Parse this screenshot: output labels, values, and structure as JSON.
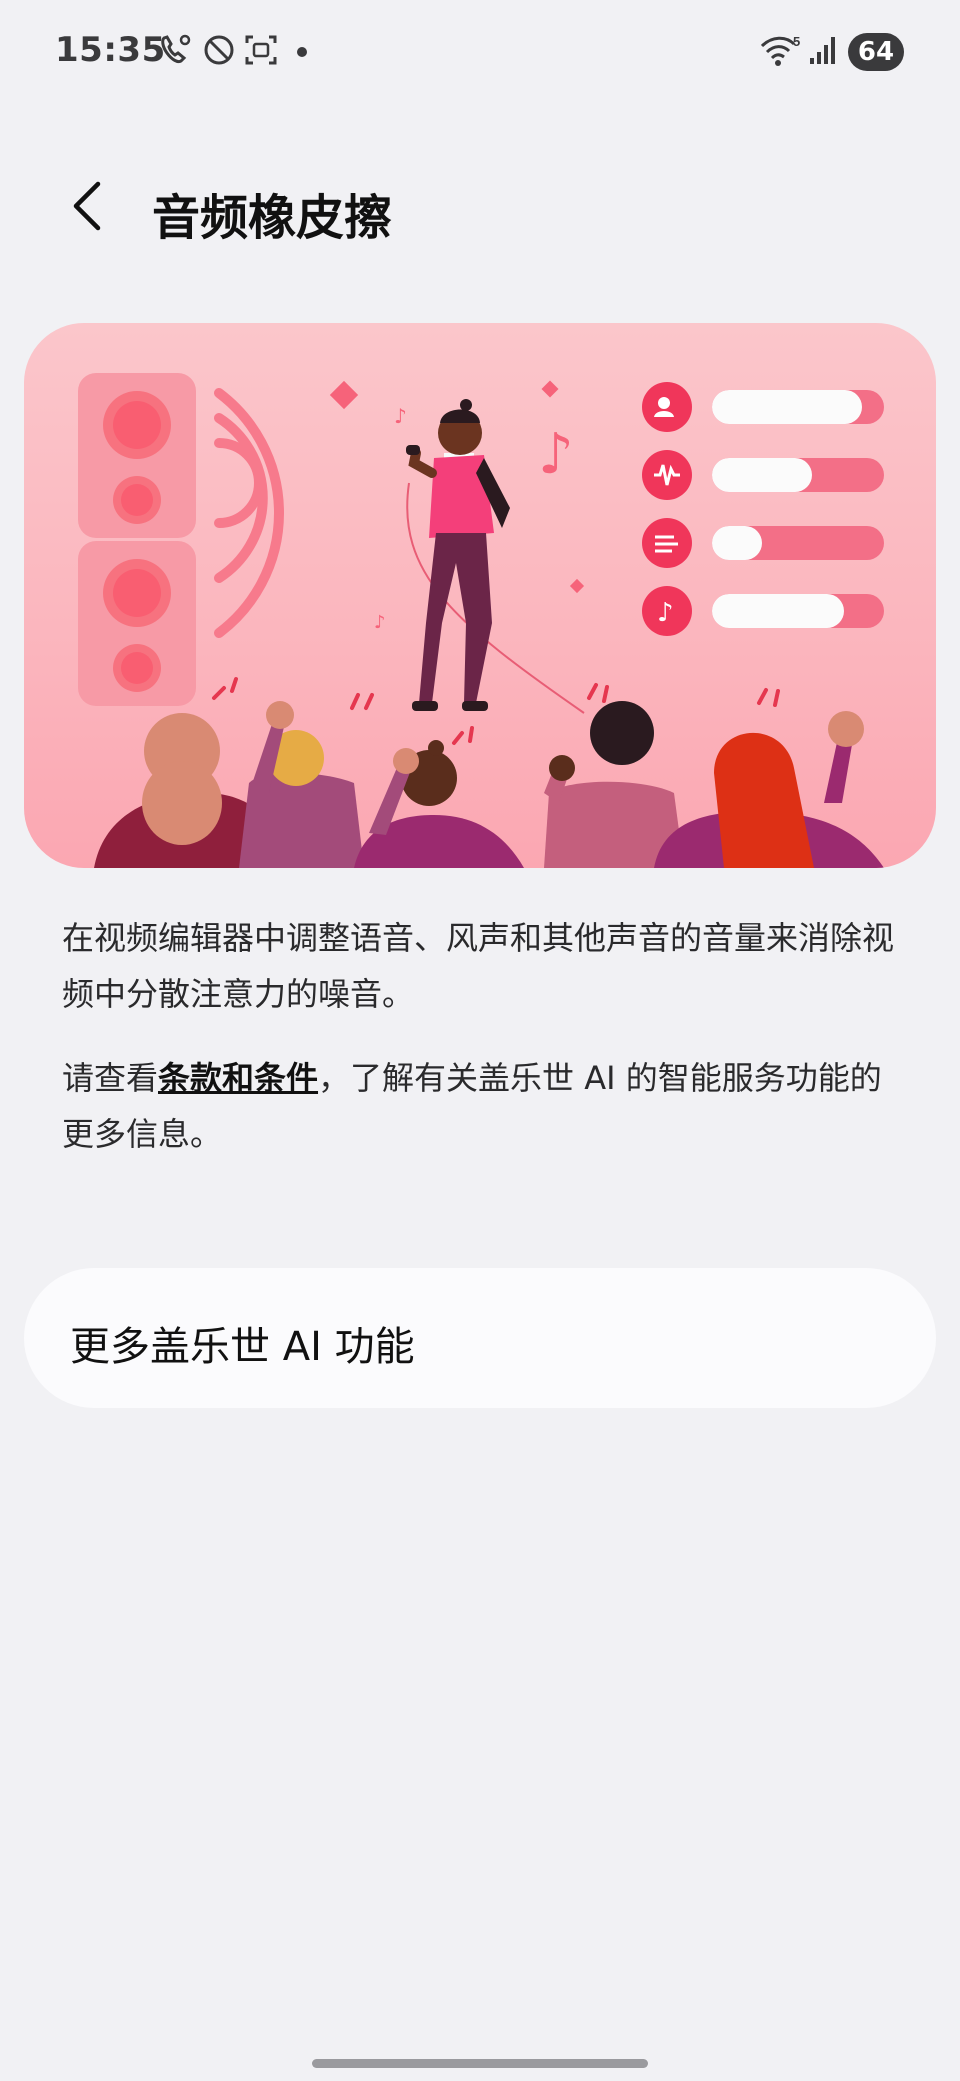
{
  "status_bar": {
    "time": "15:35",
    "battery": "64",
    "network_label": "5"
  },
  "header": {
    "title": "音频橡皮擦"
  },
  "description": {
    "paragraph1": "在视频编辑器中调整语音、风声和其他声音的音量来消除视频中分散注意力的噪音。",
    "terms_prefix": "请查看",
    "terms_link": "条款和条件",
    "terms_suffix": "，了解有关盖乐世 AI 的智能服务功能的更多信息。"
  },
  "more_card": {
    "label": "更多盖乐世 AI 功能"
  },
  "illustration": {
    "sliders": [
      {
        "icon": "voice-icon",
        "level": 0.85
      },
      {
        "icon": "waveform-icon",
        "level": 0.57
      },
      {
        "icon": "wind-icon",
        "level": 0.28
      },
      {
        "icon": "music-note-icon",
        "level": 0.75
      }
    ]
  }
}
